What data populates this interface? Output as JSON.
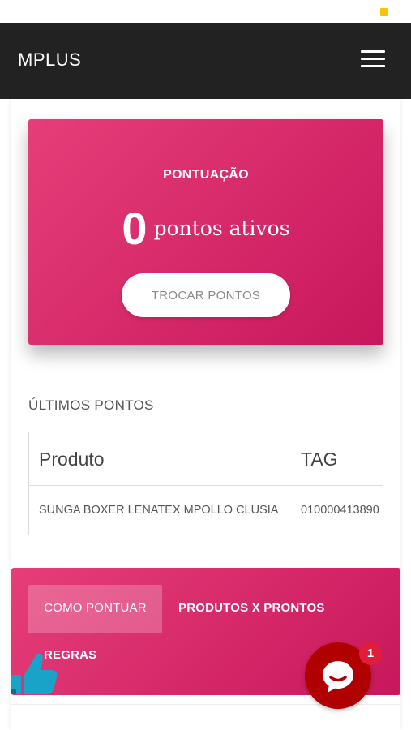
{
  "app": {
    "title": "MPLUS"
  },
  "icons": {
    "menu": "hamburger-menu-icon",
    "thumb": "thumbs-up-icon",
    "chat": "chat-bubble-icon"
  },
  "colors": {
    "app_bar": "#222222",
    "accent_pink": "#d42a6a",
    "chat_red": "#b00000",
    "badge_red": "#e01e3c"
  },
  "points_card": {
    "label": "PONTUAÇÃO",
    "value": "0",
    "suffix": "pontos ativos",
    "button_label": "TROCAR PONTOS"
  },
  "history": {
    "title": "ÚLTIMOS PONTOS",
    "columns": [
      "Produto",
      "TAG"
    ],
    "rows": [
      {
        "produto": "SUNGA BOXER LENATEX MPOLLO CLUSIA",
        "tag": "010000413890"
      }
    ]
  },
  "tabs": [
    {
      "label": "COMO PONTUAR",
      "active": true
    },
    {
      "label": "PRODUTOS X PRONTOS",
      "active": false
    },
    {
      "label": "REGRAS",
      "active": false
    }
  ],
  "chat": {
    "badge_count": "1"
  }
}
